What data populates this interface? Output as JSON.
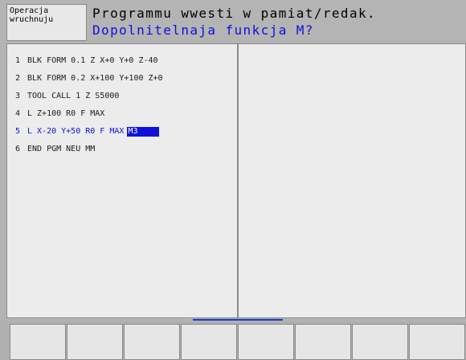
{
  "header": {
    "mode_line1": "Operacja",
    "mode_line2": "wruchnuju",
    "title": "Programmu wwesti w pamiat/redak.",
    "prompt": "Dopolnitelnaja funkcja M?"
  },
  "program": {
    "lines": [
      {
        "num": "1",
        "text": "BLK FORM 0.1 Z X+0 Y+0 Z-40"
      },
      {
        "num": "2",
        "text": "BLK FORM 0.2 X+100 Y+100 Z+0"
      },
      {
        "num": "3",
        "text": "TOOL CALL 1 Z S5000"
      },
      {
        "num": "4",
        "text": "L Z+100 R0 F MAX"
      },
      {
        "num": "5",
        "text": "L X-20 Y+50 R0 F MAX",
        "input": "M3"
      },
      {
        "num": "6",
        "text": "END PGM NEU MM"
      }
    ]
  },
  "colors": {
    "prompt": "#1010d8",
    "active_line": "#1010d8",
    "cursor_bg": "#1010d8",
    "panel_bg": "#ececec",
    "frame_bg": "#b4b4b4"
  },
  "softkeys": [
    "",
    "",
    "",
    "",
    "",
    "",
    "",
    ""
  ]
}
